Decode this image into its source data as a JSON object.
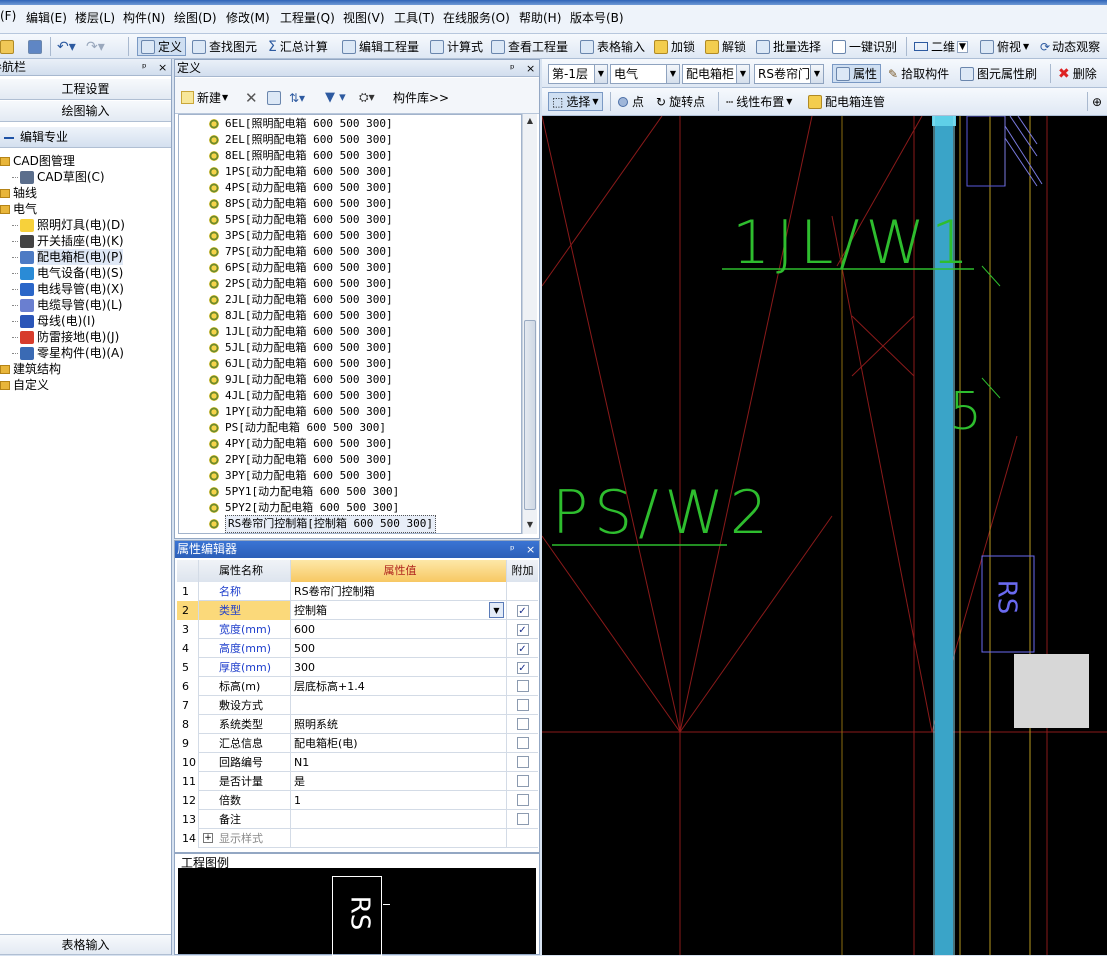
{
  "menu": [
    "(F)",
    "编辑(E)",
    "楼层(L)",
    "构件(N)",
    "绘图(D)",
    "修改(M)",
    "工程量(Q)",
    "视图(V)",
    "工具(T)",
    "在线服务(O)",
    "帮助(H)",
    "版本号(B)"
  ],
  "toolbar": {
    "define": "定义",
    "find": "查找图元",
    "summary": "汇总计算",
    "edit_quantity": "编辑工程量",
    "formula": "计算式",
    "view_quantity": "查看工程量",
    "table_input": "表格输入",
    "lock": "加锁",
    "unlock": "解锁",
    "batch_select": "批量选择",
    "one_click": "一键识别",
    "view_mode": "二维",
    "top_view": "俯视",
    "dynamic_view": "动态观察"
  },
  "nav": {
    "title": "导航栏",
    "pin": "ᵖ",
    "close": "×",
    "btn_project": "工程设置",
    "btn_draw": "绘图输入",
    "specialty": "编辑专业",
    "tree": [
      {
        "label": "CAD图管理",
        "level": 0,
        "icon": "folder-icon"
      },
      {
        "label": "CAD草图(C)",
        "level": 1,
        "icon": "cad-icon"
      },
      {
        "label": "轴线",
        "level": 0,
        "icon": "folder-icon"
      },
      {
        "label": "电气",
        "level": 0,
        "icon": "folder-icon"
      },
      {
        "label": "照明灯具(电)(D)",
        "level": 1,
        "icon": "bulb-icon"
      },
      {
        "label": "开关插座(电)(K)",
        "level": 1,
        "icon": "switch-icon"
      },
      {
        "label": "配电箱柜(电)(P)",
        "level": 1,
        "icon": "box-icon"
      },
      {
        "label": "电气设备(电)(S)",
        "level": 1,
        "icon": "device-icon"
      },
      {
        "label": "电线导管(电)(X)",
        "level": 1,
        "icon": "wire-icon"
      },
      {
        "label": "电缆导管(电)(L)",
        "level": 1,
        "icon": "cable-icon"
      },
      {
        "label": "母线(电)(I)",
        "level": 1,
        "icon": "busbar-icon"
      },
      {
        "label": "防雷接地(电)(J)",
        "level": 1,
        "icon": "lightning-icon"
      },
      {
        "label": "零星构件(电)(A)",
        "level": 1,
        "icon": "grid-icon"
      },
      {
        "label": "建筑结构",
        "level": 0,
        "icon": "folder-icon"
      },
      {
        "label": "自定义",
        "level": 0,
        "icon": "folder-icon"
      }
    ],
    "bottom": "表格输入"
  },
  "define": {
    "title": "定义",
    "new": "新建",
    "library": "构件库>>",
    "items": [
      "6EL[照明配电箱 600 500 300]",
      "2EL[照明配电箱 600 500 300]",
      "8EL[照明配电箱 600 500 300]",
      "1PS[动力配电箱 600 500 300]",
      "4PS[动力配电箱 600 500 300]",
      "8PS[动力配电箱 600 500 300]",
      "5PS[动力配电箱 600 500 300]",
      "3PS[动力配电箱 600 500 300]",
      "7PS[动力配电箱 600 500 300]",
      "6PS[动力配电箱 600 500 300]",
      "2PS[动力配电箱 600 500 300]",
      "2JL[动力配电箱 600 500 300]",
      "8JL[动力配电箱 600 500 300]",
      "1JL[动力配电箱 600 500 300]",
      "5JL[动力配电箱 600 500 300]",
      "6JL[动力配电箱 600 500 300]",
      "9JL[动力配电箱 600 500 300]",
      "4JL[动力配电箱 600 500 300]",
      "1PY[动力配电箱 600 500 300]",
      "PS[动力配电箱 600 500 300]",
      "4PY[动力配电箱 600 500 300]",
      "2PY[动力配电箱 600 500 300]",
      "3PY[动力配电箱 600 500 300]",
      "5PY1[动力配电箱 600 500 300]",
      "5PY2[动力配电箱 600 500 300]",
      "RS卷帘门控制箱[控制箱 600 500 300]"
    ]
  },
  "props": {
    "title": "属性编辑器",
    "col_name": "属性名称",
    "col_value": "属性值",
    "col_extra": "附加",
    "rows": [
      {
        "n": "1",
        "name": "名称",
        "value": "RS卷帘门控制箱",
        "blue": true,
        "check": null
      },
      {
        "n": "2",
        "name": "类型",
        "value": "控制箱",
        "blue": true,
        "check": true
      },
      {
        "n": "3",
        "name": "宽度(mm)",
        "value": "600",
        "blue": true,
        "check": true
      },
      {
        "n": "4",
        "name": "高度(mm)",
        "value": "500",
        "blue": true,
        "check": true
      },
      {
        "n": "5",
        "name": "厚度(mm)",
        "value": "300",
        "blue": true,
        "check": true
      },
      {
        "n": "6",
        "name": "标高(m)",
        "value": "层底标高+1.4",
        "blue": false,
        "check": false
      },
      {
        "n": "7",
        "name": "敷设方式",
        "value": "",
        "blue": false,
        "check": false
      },
      {
        "n": "8",
        "name": "系统类型",
        "value": "照明系统",
        "blue": false,
        "check": false
      },
      {
        "n": "9",
        "name": "汇总信息",
        "value": "配电箱柜(电)",
        "blue": false,
        "check": false
      },
      {
        "n": "10",
        "name": "回路编号",
        "value": "N1",
        "blue": false,
        "check": false
      },
      {
        "n": "11",
        "name": "是否计量",
        "value": "是",
        "blue": false,
        "check": false
      },
      {
        "n": "12",
        "name": "倍数",
        "value": "1",
        "blue": false,
        "check": false
      },
      {
        "n": "13",
        "name": "备注",
        "value": "",
        "blue": false,
        "check": false
      },
      {
        "n": "14",
        "name": "显示样式",
        "value": "",
        "blue": false,
        "check": null
      }
    ],
    "legend_title": "工程图例",
    "legend_text": "RS"
  },
  "right_toolbar": {
    "floor": "第-1层",
    "specialty": "电气",
    "component_type": "配电箱柜",
    "component": "RS卷帘门",
    "attribute": "属性",
    "pick": "拾取构件",
    "element_brush": "图元属性刷",
    "delete": "删除",
    "select": "选择",
    "point": "点",
    "rotate_point": "旋转点",
    "linear_layout": "线性布置",
    "box_connect": "配电箱连管"
  },
  "cad": {
    "label1": "1JL/W1",
    "label2": "PS/W2",
    "label3": "5",
    "box_text": "RS"
  }
}
